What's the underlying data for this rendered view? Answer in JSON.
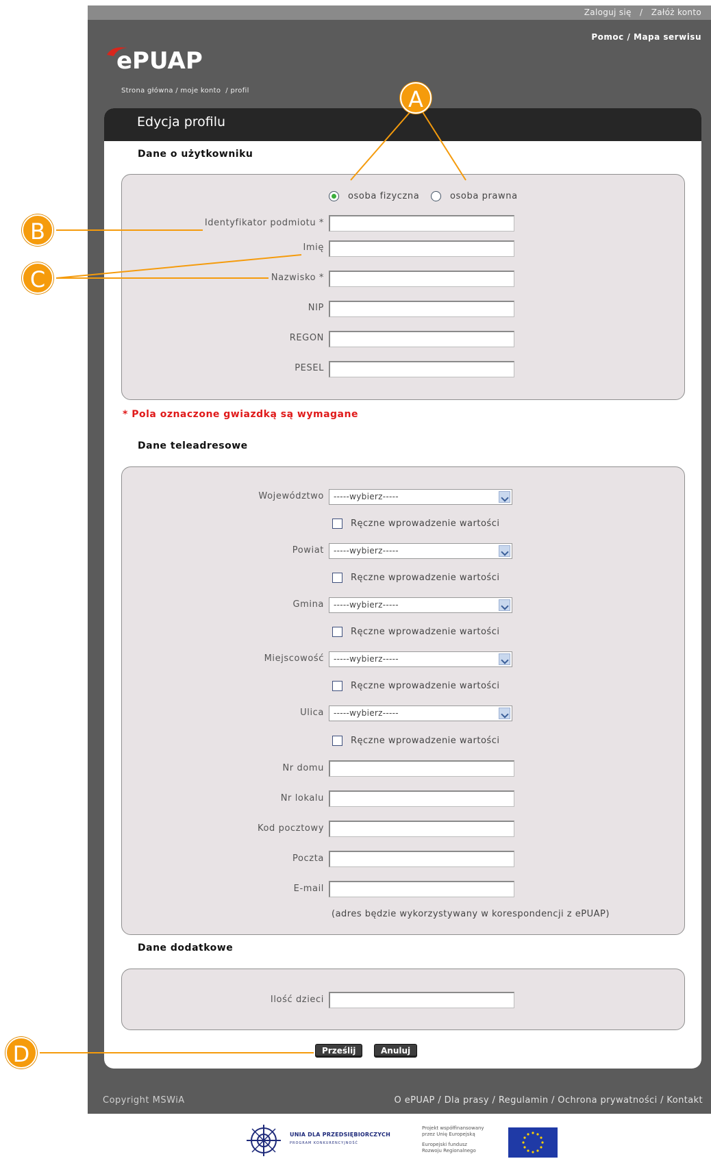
{
  "header": {
    "login_link": "Zaloguj się",
    "separator": "/",
    "register_link": "Załóż konto",
    "help_link": "Pomoc",
    "sitemap_link": "Mapa serwisu",
    "logo_text": "ePUAP"
  },
  "breadcrumb": {
    "home": "Strona główna",
    "account": "moje konto",
    "profile": "profil"
  },
  "panel": {
    "title": "Edycja profilu"
  },
  "user_section": {
    "title": "Dane o użytkowniku",
    "radio_person": "osoba fizyczna",
    "radio_company": "osoba prawna",
    "selected": "osoba fizyczna",
    "fields": [
      {
        "label": "Identyfikator podmiotu *",
        "value": ""
      },
      {
        "label": "Imię",
        "value": ""
      },
      {
        "label": "Nazwisko *",
        "value": ""
      },
      {
        "label": "NIP",
        "value": ""
      },
      {
        "label": "REGON",
        "value": ""
      },
      {
        "label": "PESEL",
        "value": ""
      }
    ],
    "required_note": "*  Pola oznaczone gwiazdką są wymagane"
  },
  "address_section": {
    "title": "Dane teleadresowe",
    "selects": [
      {
        "label": "Województwo",
        "value": "-----wybierz-----"
      },
      {
        "label": "Powiat",
        "value": "-----wybierz-----"
      },
      {
        "label": "Gmina",
        "value": "-----wybierz-----"
      },
      {
        "label": "Miejscowość",
        "value": "-----wybierz-----"
      },
      {
        "label": "Ulica",
        "value": "-----wybierz-----"
      }
    ],
    "manual_checkbox_label": "Ręczne wprowadzenie wartości",
    "fields": [
      {
        "label": "Nr domu",
        "value": ""
      },
      {
        "label": "Nr lokalu",
        "value": ""
      },
      {
        "label": "Kod pocztowy",
        "value": ""
      },
      {
        "label": "Poczta",
        "value": ""
      },
      {
        "label": "E-mail",
        "value": ""
      }
    ],
    "email_note": "(adres będzie wykorzystywany w korespondencji z ePUAP)"
  },
  "extra_section": {
    "title": "Dane dodatkowe",
    "children_label": "Ilość dzieci",
    "children_value": ""
  },
  "buttons": {
    "submit": "Prześlij",
    "cancel": "Anuluj"
  },
  "footer": {
    "copyright": "Copyright MSWiA",
    "links": "O ePUAP / Dla prasy / Regulamin / Ochrona prywatności / Kontakt",
    "ue_title": "UNIA DLA PRZEDSIĘBIORCZYCH",
    "ue_sub": "PROGRAM KONKURENCYJNOŚĆ",
    "project_lines": [
      "Projekt współfinansowany",
      "przez Unię Europejską",
      "",
      "Europejski fundusz",
      "Rozwoju Regionalnego"
    ]
  },
  "callouts": {
    "a": "A",
    "b": "B",
    "c": "C",
    "d": "D"
  },
  "colors": {
    "callout": "#f59b0c",
    "required": "#e01a1a",
    "panel_head": "#262626",
    "page_bg": "#5b5b5b"
  }
}
